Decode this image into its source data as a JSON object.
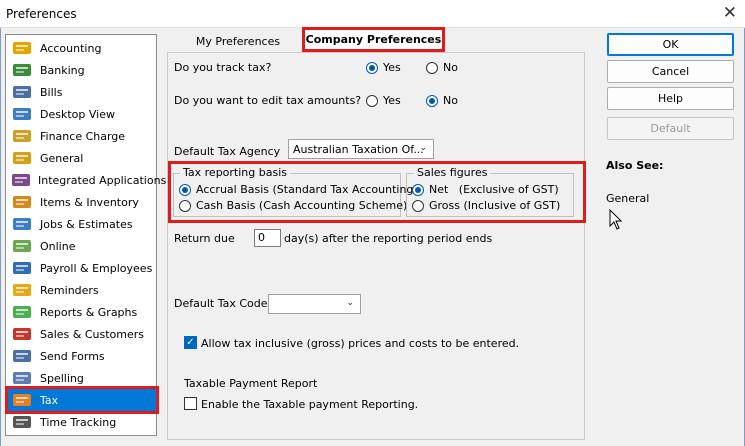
{
  "window": {
    "title": "Preferences"
  },
  "sidebar": {
    "items": [
      {
        "label": "Accounting",
        "icon": "accounting-icon",
        "color": "#e0a800"
      },
      {
        "label": "Banking",
        "icon": "banking-icon",
        "color": "#3a8c3a"
      },
      {
        "label": "Bills",
        "icon": "bills-icon",
        "color": "#4a6fa5"
      },
      {
        "label": "Desktop View",
        "icon": "desktop-view-icon",
        "color": "#3e7cc4"
      },
      {
        "label": "Finance Charge",
        "icon": "finance-charge-icon",
        "color": "#c9a227"
      },
      {
        "label": "General",
        "icon": "general-icon",
        "color": "#d4a017"
      },
      {
        "label": "Integrated Applications",
        "icon": "integrated-apps-icon",
        "color": "#7a4a8a"
      },
      {
        "label": "Items & Inventory",
        "icon": "items-inventory-icon",
        "color": "#d48a1a"
      },
      {
        "label": "Jobs & Estimates",
        "icon": "jobs-estimates-icon",
        "color": "#3a7fc1"
      },
      {
        "label": "Online",
        "icon": "online-icon",
        "color": "#6aa84f"
      },
      {
        "label": "Payroll & Employees",
        "icon": "payroll-icon",
        "color": "#2f6eb5"
      },
      {
        "label": "Reminders",
        "icon": "reminders-icon",
        "color": "#e6a817"
      },
      {
        "label": "Reports & Graphs",
        "icon": "reports-graphs-icon",
        "color": "#4caf50"
      },
      {
        "label": "Sales & Customers",
        "icon": "sales-customers-icon",
        "color": "#c0392b"
      },
      {
        "label": "Send Forms",
        "icon": "send-forms-icon",
        "color": "#4a6fa5"
      },
      {
        "label": "Spelling",
        "icon": "spelling-icon",
        "color": "#5b7db1"
      },
      {
        "label": "Tax",
        "icon": "tax-icon",
        "color": "#e67e22"
      },
      {
        "label": "Time Tracking",
        "icon": "time-tracking-icon",
        "color": "#555555"
      }
    ],
    "selected": "Tax"
  },
  "tabs": {
    "my": "My Preferences",
    "company": "Company Preferences"
  },
  "panel": {
    "track_tax": {
      "question": "Do you track tax?",
      "yes": "Yes",
      "no": "No",
      "value": "Yes"
    },
    "edit_tax": {
      "question": "Do you want to edit tax amounts?",
      "yes": "Yes",
      "no": "No",
      "value": "No"
    },
    "default_agency": {
      "label": "Default Tax Agency",
      "value": "Australian Taxation Of..."
    },
    "reporting_basis": {
      "title": "Tax reporting basis",
      "accrual": "Accrual Basis (Standard Tax Accounting)",
      "cash": "Cash Basis (Cash Accounting Scheme)",
      "value": "accrual"
    },
    "sales_figures": {
      "title": "Sales figures",
      "net": "Net   (Exclusive of GST)",
      "gross": "Gross (Inclusive of GST)",
      "value": "net"
    },
    "return_due": {
      "label": "Return due",
      "value": "0",
      "suffix": "day(s) after the reporting period ends"
    },
    "default_tax_code": {
      "label": "Default Tax Code",
      "value": ""
    },
    "allow_inclusive": {
      "label": "Allow tax inclusive (gross) prices and costs to be entered.",
      "checked": true
    },
    "taxable_payment": {
      "heading": "Taxable Payment Report",
      "label": "Enable the Taxable payment Reporting.",
      "checked": false
    }
  },
  "buttons": {
    "ok": "OK",
    "cancel": "Cancel",
    "help": "Help",
    "default": "Default"
  },
  "also_see": {
    "heading": "Also See:",
    "link": "General"
  },
  "colors": {
    "accent": "#0078d7",
    "highlight": "#e01b1b"
  }
}
